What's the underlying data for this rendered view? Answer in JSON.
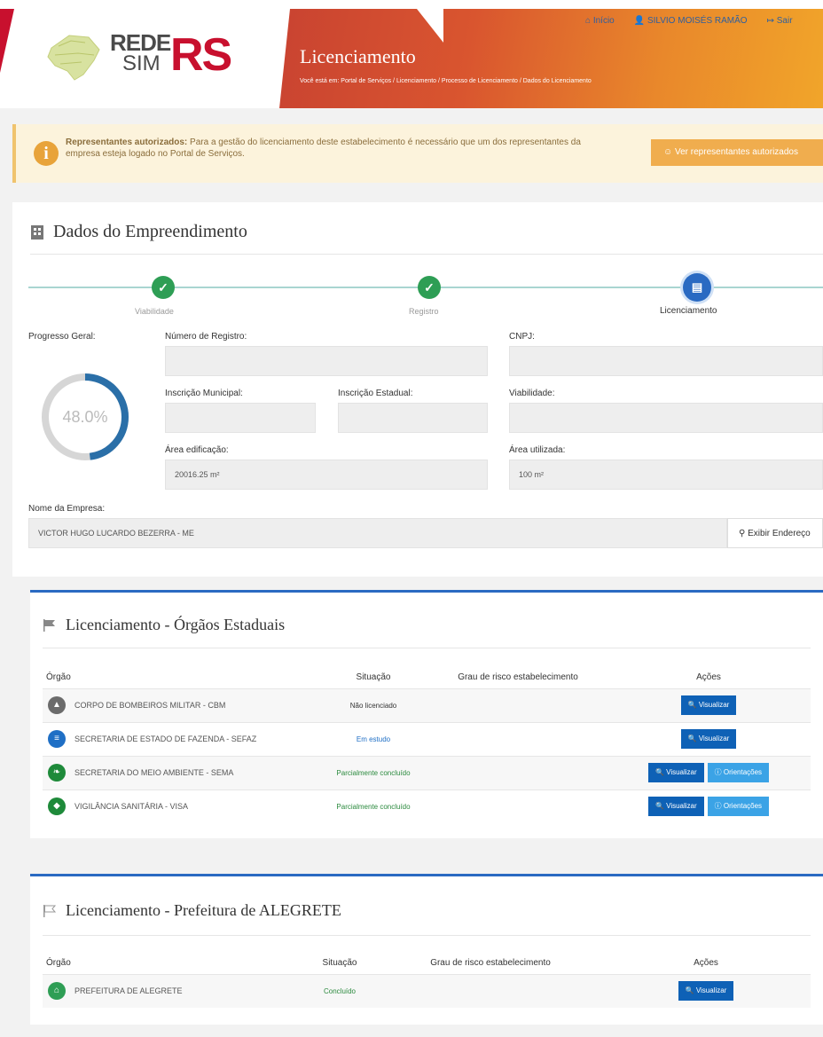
{
  "header": {
    "logo": {
      "rede": "REDE",
      "sim": "SIM",
      "rs": "RS"
    },
    "nav": {
      "home": "Início",
      "user": "SILVIO MOISÉS RAMÃO",
      "logout": "Sair"
    },
    "title": "Licenciamento",
    "breadcrumb": "Você está em: Portal de Serviços / Licenciamento / Processo de Licenciamento / Dados do Licenciamento"
  },
  "alert": {
    "bold": "Representantes autorizados:",
    "text": " Para a gestão do licenciamento deste estabelecimento é necessário que um dos representantes da empresa esteja logado no Portal de Serviços.",
    "button": "Ver representantes autorizados"
  },
  "main": {
    "title": "Dados do Empreendimento",
    "steps": [
      {
        "label": "Viabilidade",
        "status": "done"
      },
      {
        "label": "Registro",
        "status": "done"
      },
      {
        "label": "Licenciamento",
        "status": "active"
      }
    ],
    "progress": {
      "label": "Progresso Geral:",
      "value": 48.0,
      "text": "48.0%"
    },
    "fields": {
      "registro": {
        "label": "Número de Registro:",
        "value": ""
      },
      "cnpj": {
        "label": "CNPJ:",
        "value": ""
      },
      "municipal": {
        "label": "Inscrição Municipal:",
        "value": ""
      },
      "estadual": {
        "label": "Inscrição Estadual:",
        "value": ""
      },
      "viabilidade": {
        "label": "Viabilidade:",
        "value": ""
      },
      "area_edif": {
        "label": "Área edificação:",
        "value": "20016.25 m²"
      },
      "area_util": {
        "label": "Área utilizada:",
        "value": "100 m²"
      },
      "empresa": {
        "label": "Nome da Empresa:",
        "value": "VICTOR HUGO LUCARDO BEZERRA - ME"
      }
    },
    "address_button": "Exibir Endereço"
  },
  "state": {
    "title": "Licenciamento - Órgãos Estaduais",
    "columns": [
      "Órgão",
      "Situação",
      "Grau de risco estabelecimento",
      "Ações"
    ],
    "rows": [
      {
        "org": "CORPO DE BOMBEIROS MILITAR - CBM",
        "status": "Não licenciado",
        "status_color": "#333333",
        "icon_color": "#6b6b6b",
        "guidance": false
      },
      {
        "org": "SECRETARIA DE ESTADO DE FAZENDA - SEFAZ",
        "status": "Em estudo",
        "status_color": "#1f6fc5",
        "icon_color": "#1f6fc5",
        "guidance": false
      },
      {
        "org": "SECRETARIA DO MEIO AMBIENTE - SEMA",
        "status": "Parcialmente concluído",
        "status_color": "#2b8a3e",
        "icon_color": "#1e8a3a",
        "guidance": true
      },
      {
        "org": "VIGILÂNCIA SANITÁRIA - VISA",
        "status": "Parcialmente concluído",
        "status_color": "#2b8a3e",
        "icon_color": "#1e8a3a",
        "guidance": true
      }
    ],
    "view_label": "Visualizar",
    "guidance_label": "Orientações"
  },
  "city": {
    "title": "Licenciamento - Prefeitura de ALEGRETE",
    "columns": [
      "Órgão",
      "Situação",
      "Grau de risco estabelecimento",
      "Ações"
    ],
    "rows": [
      {
        "org": "PREFEITURA DE ALEGRETE",
        "status": "Concluído",
        "status_color": "#2b8a3e",
        "icon_color": "#2e9e55"
      }
    ],
    "view_label": "Visualizar"
  }
}
